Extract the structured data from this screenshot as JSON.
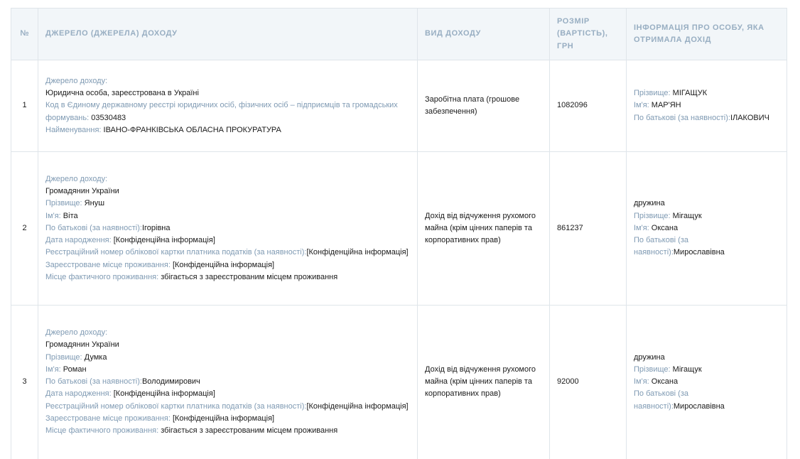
{
  "headers": {
    "num": "№",
    "source": "ДЖЕРЕЛО (ДЖЕРЕЛА) ДОХОДУ",
    "type": "ВИД ДОХОДУ",
    "amount": "РОЗМІР (ВАРТІСТЬ), ГРН",
    "person": "ІНФОРМАЦІЯ ПРО ОСОБУ, ЯКА ОТРИМАЛА ДОХІД"
  },
  "rows": [
    {
      "num": "1",
      "source": {
        "label_source": "Джерело доходу:",
        "source_kind": "Юридична особа, зареєстрована в Україні",
        "label_code": "Код в Єдиному державному реєстрі юридичних осіб, фізичних осіб – підприємців та громадських формувань:",
        "code": "03530483",
        "label_name": "Найменування:",
        "name": "ІВАНО-ФРАНКІВСЬКА ОБЛАСНА ПРОКУРАТУРА"
      },
      "type": "Заробітна плата (грошове забезпечення)",
      "amount": "1082096",
      "person": {
        "relation": "",
        "label_surname": "Прізвище:",
        "surname": "МІГАЩУК",
        "label_firstname": "Ім'я:",
        "firstname": "МАР'ЯН",
        "label_patronymic": "По батькові (за наявності):",
        "patronymic": "ІЛАКОВИЧ"
      }
    },
    {
      "num": "2",
      "source": {
        "label_source": "Джерело доходу:",
        "source_kind": "Громадянин України",
        "label_surname": "Прізвище:",
        "surname": "Януш",
        "label_firstname": "Ім'я:",
        "firstname": "Віта",
        "label_patronymic": "По батькові (за наявності):",
        "patronymic": "Ігорівна",
        "label_birth": "Дата народження:",
        "birth": "[Конфіденційна інформація]",
        "label_tax": "Реєстраційний номер облікової картки платника податків (за наявності):",
        "tax": "[Конфіденційна інформація]",
        "label_reg": "Зареєстроване місце проживання:",
        "reg": "[Конфіденційна інформація]",
        "label_actual": "Місце фактичного проживання:",
        "actual": "збігається з зареєстрованим місцем проживання"
      },
      "type": "Дохід від відчуження рухомого майна (крім цінних паперів та корпоративних прав)",
      "amount": "861237",
      "person": {
        "relation": "дружина",
        "label_surname": "Прізвище:",
        "surname": "Мігащук",
        "label_firstname": "Ім'я:",
        "firstname": "Оксана",
        "label_patronymic": "По батькові (за наявності):",
        "patronymic": "Мирославівна"
      }
    },
    {
      "num": "3",
      "source": {
        "label_source": "Джерело доходу:",
        "source_kind": "Громадянин України",
        "label_surname": "Прізвище:",
        "surname": "Думка",
        "label_firstname": "Ім'я:",
        "firstname": "Роман",
        "label_patronymic": "По батькові (за наявності):",
        "patronymic": "Володимирович",
        "label_birth": "Дата народження:",
        "birth": "[Конфіденційна інформація]",
        "label_tax": "Реєстраційний номер облікової картки платника податків (за наявності):",
        "tax": "[Конфіденційна інформація]",
        "label_reg": "Зареєстроване місце проживання:",
        "reg": "[Конфіденційна інформація]",
        "label_actual": "Місце фактичного проживання:",
        "actual": "збігається з зареєстрованим місцем проживання"
      },
      "type": "Дохід від відчуження рухомого майна (крім цінних паперів та корпоративних прав)",
      "amount": "92000",
      "person": {
        "relation": "дружина",
        "label_surname": "Прізвище:",
        "surname": "Мігащук",
        "label_firstname": "Ім'я:",
        "firstname": "Оксана",
        "label_patronymic": "По батькові (за наявності):",
        "patronymic": "Мирославівна"
      }
    }
  ]
}
